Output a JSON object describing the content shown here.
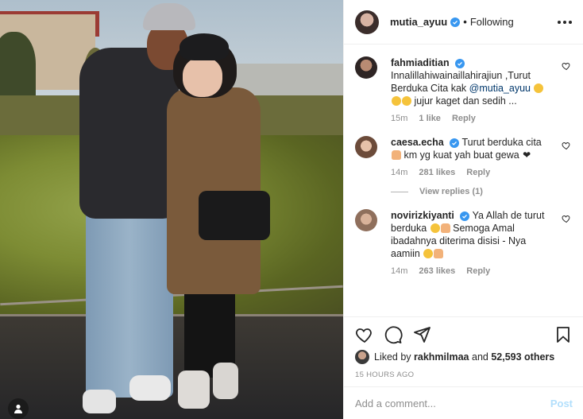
{
  "header": {
    "username": "mutia_ayuu",
    "separator": "•",
    "follow_status": "Following"
  },
  "comments": [
    {
      "username": "fahmiaditian",
      "verified": true,
      "text_before": "Innalillahiwainaillahirajiun ,Turut Berduka Cita kak ",
      "mention": "@mutia_ayuu",
      "text_after": " jujur kaget dan sedih ...",
      "time": "15m",
      "likes": "1 like",
      "reply": "Reply"
    },
    {
      "username": "caesa.echa",
      "verified": true,
      "text_before": "Turut berduka cita",
      "text_after": " km yg kuat yah buat gewa ",
      "time": "14m",
      "likes": "281 likes",
      "reply": "Reply",
      "view_replies": "View replies (1)"
    },
    {
      "username": "novirizkiyanti",
      "verified": true,
      "text_before": "Ya Allah de turut berduka ",
      "text_after": " Semoga Amal ibadahnya diterima disisi - Nya aamiin ",
      "time": "14m",
      "likes": "263 likes",
      "reply": "Reply"
    }
  ],
  "liked_by": {
    "prefix": "Liked by ",
    "user": "rakhmilmaa",
    "and": " and ",
    "count": "52,593 others"
  },
  "timestamp": "15 HOURS AGO",
  "add_comment": {
    "placeholder": "Add a comment...",
    "post_label": "Post"
  },
  "colors": {
    "verified": "#3897f0",
    "post_disabled": "#b2dffc",
    "mention": "#00376b",
    "meta_gray": "#8e8e8e"
  }
}
